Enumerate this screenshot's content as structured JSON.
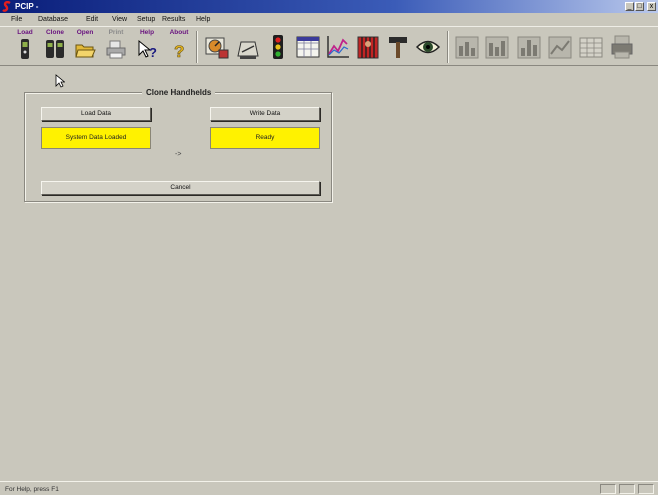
{
  "window": {
    "title": "PCIP -",
    "min_glyph": "_",
    "max_glyph": "□",
    "close_glyph": "x"
  },
  "menu": [
    "File",
    "Database",
    "Edit",
    "View",
    "Setup",
    "Results",
    "Help"
  ],
  "toolbar": {
    "load": "Load",
    "clone": "Clone",
    "open": "Open",
    "print": "Print",
    "help": "Help",
    "about": "About",
    "big_icons": [
      "calibration-icon",
      "scale-icon",
      "traffic-light-icon",
      "grid-chart-icon",
      "line-chart-icon",
      "jail-icon",
      "hammer-icon",
      "eye-icon"
    ],
    "disabled_icons": [
      "bar-chart-icon",
      "bar-chart-icon",
      "bar-chart-icon",
      "bar-chart-icon",
      "table-chart-icon",
      "printer-chart-icon"
    ]
  },
  "dialog": {
    "title": "Clone Handhelds",
    "load_label": "Load Data",
    "write_label": "Write Data",
    "load_status": "System Data Loaded",
    "write_status": "Ready",
    "arrow": "->",
    "cancel_label": "Cancel",
    "status_color": "#fff200"
  },
  "statusbar": {
    "text": "For Help, press F1"
  }
}
